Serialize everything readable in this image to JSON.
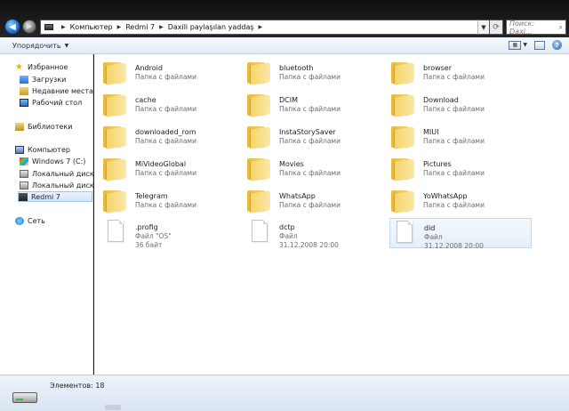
{
  "address": {
    "crumbs": [
      "Компьютер",
      "Redmi 7",
      "Daxili paylaşılan yaddaş"
    ]
  },
  "search": {
    "placeholder": "Поиск: Daxi..."
  },
  "toolbar": {
    "organize_label": "Упорядочить"
  },
  "nav": {
    "favorites": "Избранное",
    "downloads": "Загрузки",
    "recent": "Недавние места",
    "desktop": "Рабочий стол",
    "libraries": "Библиотеки",
    "computer": "Компьютер",
    "drive_c": "Windows 7 (C:)",
    "drive_d": "Локальный диск (D:)",
    "drive_e": "Локальный диск (E:)",
    "phone": "Redmi 7",
    "network": "Сеть"
  },
  "items": [
    {
      "name": "Android",
      "desc": "Папка с файлами",
      "kind": "folder"
    },
    {
      "name": "bluetooth",
      "desc": "Папка с файлами",
      "kind": "folder"
    },
    {
      "name": "browser",
      "desc": "Папка с файлами",
      "kind": "folder"
    },
    {
      "name": "cache",
      "desc": "Папка с файлами",
      "kind": "folder"
    },
    {
      "name": "DCIM",
      "desc": "Папка с файлами",
      "kind": "folder"
    },
    {
      "name": "Download",
      "desc": "Папка с файлами",
      "kind": "folder"
    },
    {
      "name": "downloaded_rom",
      "desc": "Папка с файлами",
      "kind": "folder"
    },
    {
      "name": "InstaStorySaver",
      "desc": "Папка с файлами",
      "kind": "folder"
    },
    {
      "name": "MIUI",
      "desc": "Папка с файлами",
      "kind": "folder"
    },
    {
      "name": "MiVideoGlobal",
      "desc": "Папка с файлами",
      "kind": "folder"
    },
    {
      "name": "Movies",
      "desc": "Папка с файлами",
      "kind": "folder"
    },
    {
      "name": "Pictures",
      "desc": "Папка с файлами",
      "kind": "folder"
    },
    {
      "name": "Telegram",
      "desc": "Папка с файлами",
      "kind": "folder"
    },
    {
      "name": "WhatsApp",
      "desc": "Папка с файлами",
      "kind": "folder"
    },
    {
      "name": "YoWhatsApp",
      "desc": "Папка с файлами",
      "kind": "folder"
    },
    {
      "name": ".profig",
      "desc": "Файл \"OS\"",
      "desc2": "36 байт",
      "kind": "file"
    },
    {
      "name": "dctp",
      "desc": "Файл",
      "desc2": "31.12.2008 20:00",
      "kind": "file"
    },
    {
      "name": "did",
      "desc": "Файл",
      "desc2": "31.12.2008 20:00",
      "kind": "file",
      "selected": true
    }
  ],
  "status": {
    "count_text": "Элементов: 18"
  }
}
